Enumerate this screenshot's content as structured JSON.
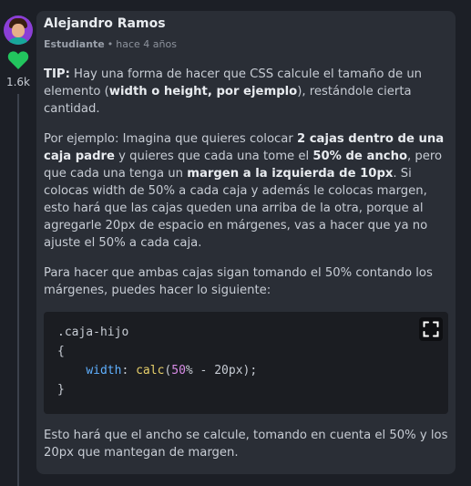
{
  "comment": {
    "author": "Alejandro Ramos",
    "role": "Estudiante",
    "separator": "•",
    "time": "hace 4 años",
    "likes": "1.6k",
    "colors": {
      "accent_heart": "#22c55e",
      "card_bg": "#2a2e36",
      "page_bg": "#1c1f26"
    },
    "paragraphs": [
      [
        {
          "text": "TIP:",
          "bold": true
        },
        {
          "text": " Hay una forma de hacer que CSS calcule el tamaño de un elemento (",
          "bold": false
        },
        {
          "text": "width o height, por ejemplo",
          "bold": true
        },
        {
          "text": "), restándole cierta cantidad.",
          "bold": false
        }
      ],
      [
        {
          "text": "Por ejemplo: Imagina que quieres colocar ",
          "bold": false
        },
        {
          "text": "2 cajas dentro de una caja padre",
          "bold": true
        },
        {
          "text": " y quieres que cada una tome el ",
          "bold": false
        },
        {
          "text": "50% de ancho",
          "bold": true
        },
        {
          "text": ", pero que cada una tenga un ",
          "bold": false
        },
        {
          "text": "margen a la izquierda de 10px",
          "bold": true
        },
        {
          "text": ". Si colocas width de 50% a cada caja y además le colocas margen, esto hará que las cajas queden una arriba de la otra, porque al agregarle 20px de espacio en márgenes, vas a hacer que ya no ajuste el 50% a cada caja.",
          "bold": false
        }
      ],
      [
        {
          "text": "Para hacer que ambas cajas sigan tomando el 50% contando los márgenes, puedes hacer lo siguiente:",
          "bold": false
        }
      ]
    ],
    "code": {
      "line1": ".caja-hijo",
      "line2": "{",
      "line3_indent": "    ",
      "line3_prop": "width",
      "line3_colon": ": ",
      "line3_fn": "calc",
      "line3_open": "(",
      "line3_num": "50",
      "line3_rest": "% - 20px);",
      "line4": "}"
    },
    "closing": "Esto hará que el ancho se calcule, tomando en cuenta el 50% y los 20px que mantegan de margen.",
    "icons": {
      "like": "heart-icon",
      "expand": "expand-icon"
    }
  }
}
